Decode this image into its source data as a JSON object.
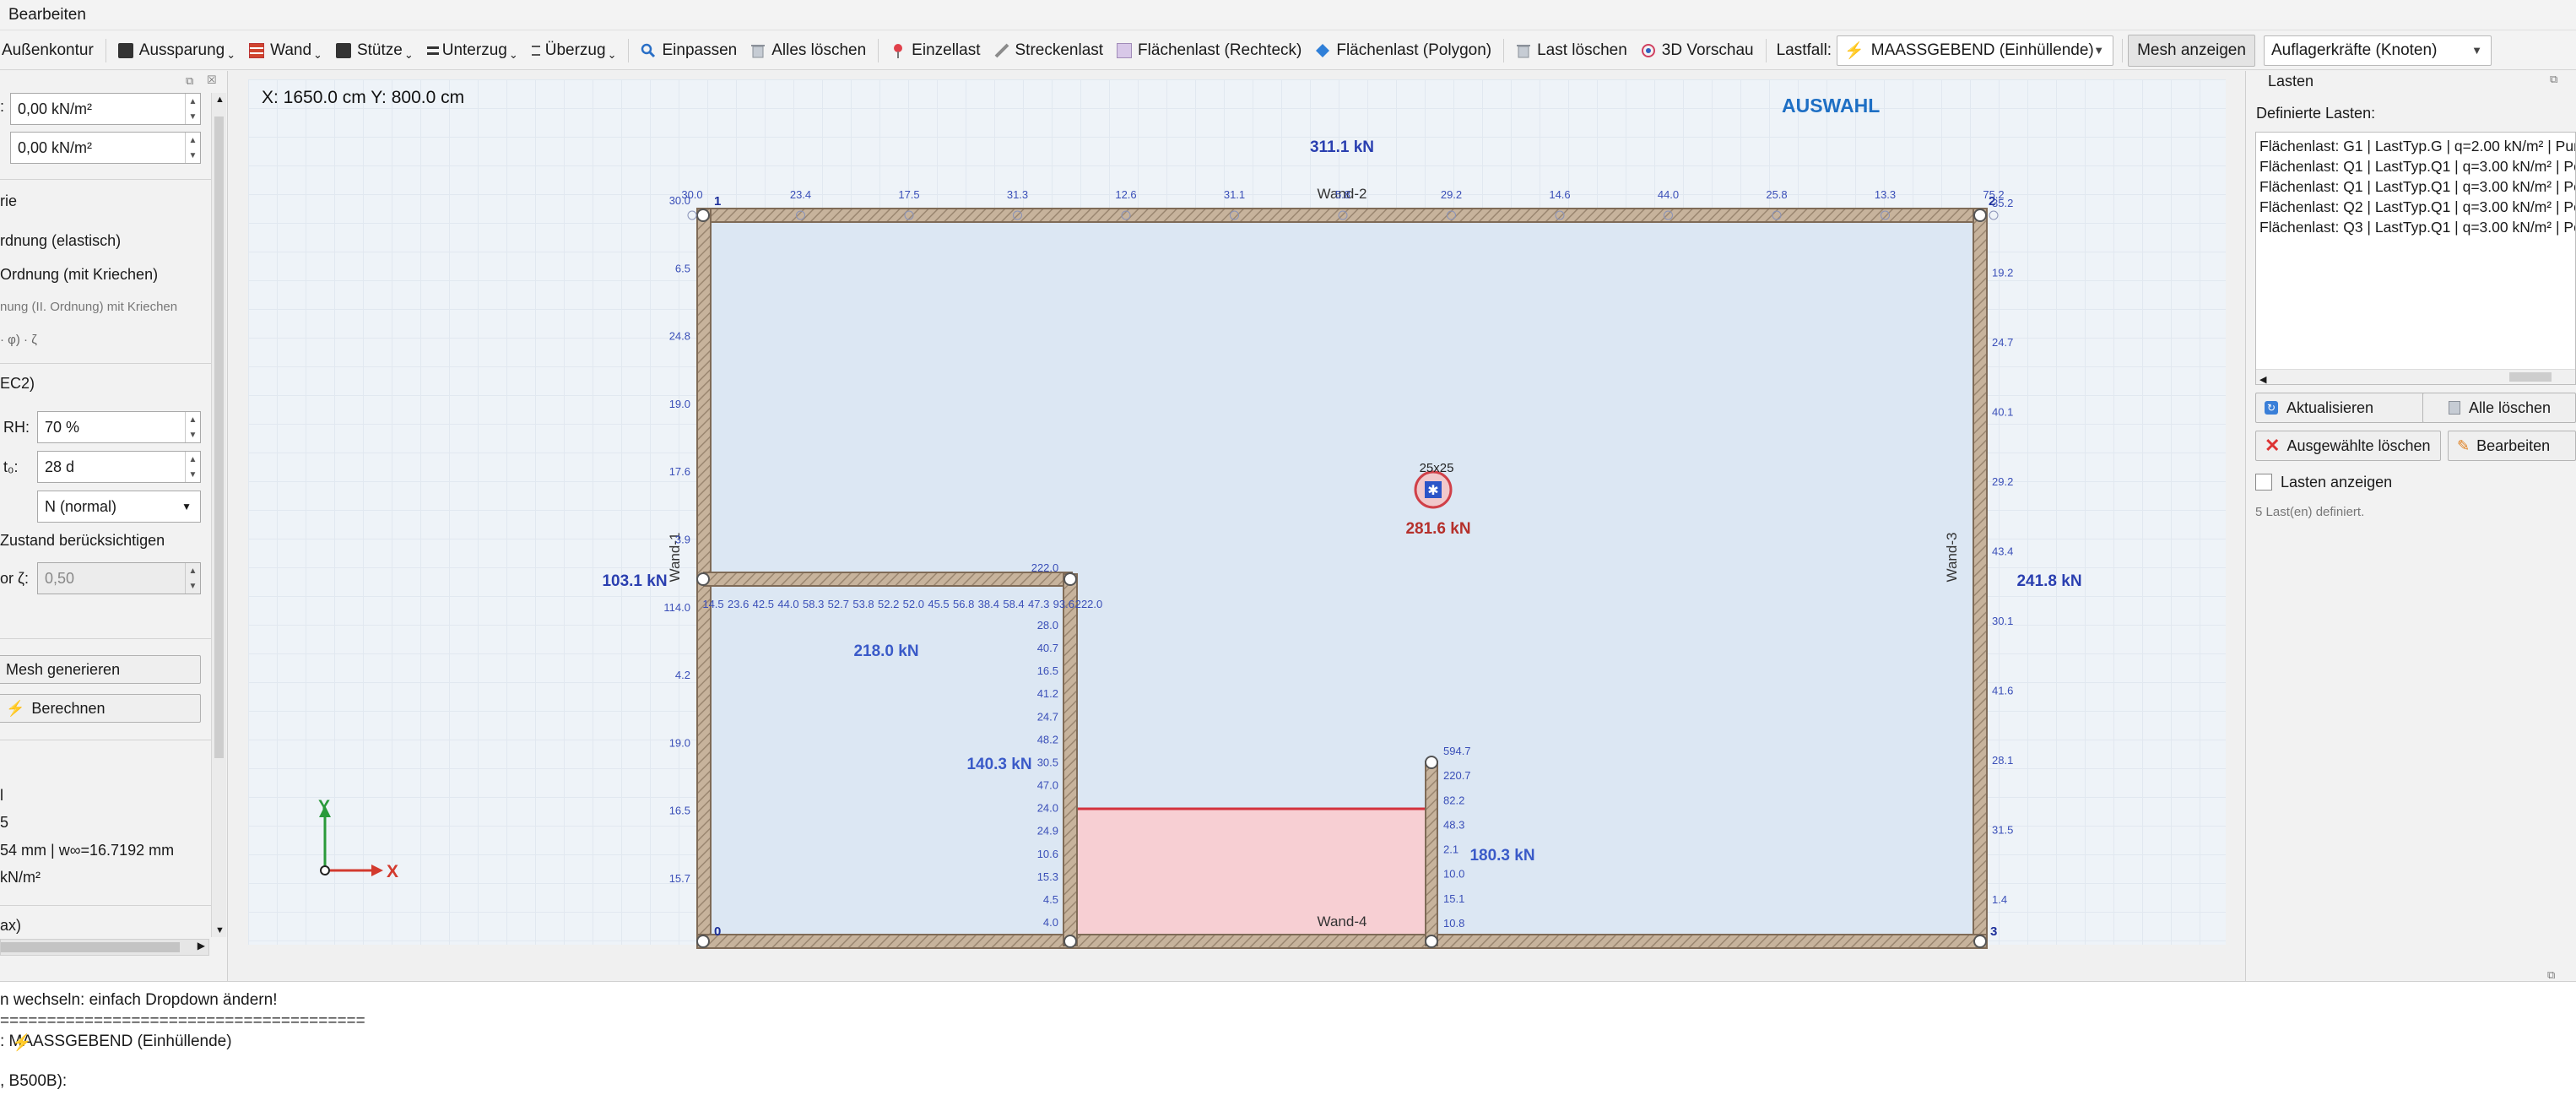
{
  "menubar": {
    "bearbeiten": "Bearbeiten"
  },
  "toolbar": {
    "aussenkontur": "Außenkontur",
    "aussparung": "Aussparung",
    "wand": "Wand",
    "stuetze": "Stütze",
    "unterzug": "Unterzug",
    "ueberzug": "Überzug",
    "einpassen": "Einpassen",
    "alles_loeschen": "Alles löschen",
    "einzellast": "Einzellast",
    "streckenlast": "Streckenlast",
    "flaechenlast_rechteck": "Flächenlast (Rechteck)",
    "flaechenlast_polygon": "Flächenlast (Polygon)",
    "last_loeschen": "Last löschen",
    "vorschau_3d": "3D Vorschau",
    "lastfall_label": "Lastfall:",
    "lastfall_value": "MAASSGEBEND (Einhüllende)",
    "mesh_anzeigen": "Mesh anzeigen",
    "ergebnis_value": "Auflagerkräfte (Knoten)"
  },
  "left_panel": {
    "field1_value": "0,00 kN/m²",
    "field2_value": "0,00 kN/m²",
    "section_theorie": "rie",
    "option_elastisch": "rdnung (elastisch)",
    "option_kriechen": "Ordnung (mit Kriechen)",
    "hint_kriechen": "nung (II. Ordnung) mit Kriechen",
    "formula": "· φ) · ζ",
    "section_ec2": "EC2)",
    "rh_label": "RH:",
    "rh_value": "70 %",
    "t0_label": "t₀:",
    "t0_value": "28 d",
    "cement_value": "N (normal)",
    "zustand_label": "Zustand berücksichtigen",
    "zeta_label": "or ζ:",
    "zeta_value": "0,50",
    "mesh_button": "Mesh generieren",
    "calc_button": "Berechnen",
    "res1": "l",
    "res2": "5",
    "res3": "54 mm  |  w∞=16.7192 mm",
    "res4": "kN/m²",
    "res5": "ax)"
  },
  "canvas": {
    "coord_readout": "X: 1650.0 cm  Y: 800.0 cm",
    "auswahl_label": "AUSWAHL",
    "axis_y": "Y",
    "axis_x": "X",
    "wall_labels": [
      "Wand-1",
      "Wand-2",
      "Wand-3",
      "Wand-4"
    ],
    "node_labels": [
      "0",
      "1",
      "2",
      "3"
    ],
    "column_label": "25x25",
    "reactions": {
      "top": "311.1 kN",
      "left": "103.1 kN",
      "right": "241.8 kN",
      "inner_horizontal": "218.0 kN",
      "inner_vertical": "140.3 kN",
      "stub": "180.3 kN",
      "column": "281.6 kN"
    },
    "top_edge_values": [
      "30.0",
      "23.4",
      "17.5",
      "31.3",
      "12.6",
      "31.1",
      "5.8",
      "29.2",
      "14.6",
      "44.0",
      "25.8",
      "13.3",
      "75.2"
    ],
    "left_edge_values": [
      "30.0",
      "6.5",
      "24.8",
      "19.0",
      "17.6",
      "3.9",
      "114.0",
      "4.2",
      "19.0",
      "16.5",
      "15.7"
    ],
    "right_edge_values": [
      "35.2",
      "19.2",
      "24.7",
      "40.1",
      "29.2",
      "43.4",
      "30.1",
      "41.6",
      "28.1",
      "31.5",
      "1.4"
    ],
    "inner_horizontal_values": [
      "14.5",
      "23.6",
      "42.5",
      "44.0",
      "58.3",
      "52.7",
      "53.8",
      "52.2",
      "52.0",
      "45.5",
      "56.8",
      "38.4",
      "58.4",
      "47.3",
      "93.6",
      "222.0"
    ],
    "inner_top_value": "222.0",
    "inner_vertical_values": [
      "28.0",
      "40.7",
      "16.5",
      "41.2",
      "24.7",
      "48.2",
      "30.5",
      "47.0",
      "24.0",
      "24.9",
      "10.6",
      "15.3",
      "4.5",
      "4.0"
    ],
    "stub_values": [
      "594.7",
      "220.7",
      "82.2",
      "48.3",
      "2.1",
      "10.0",
      "15.1",
      "10.8"
    ]
  },
  "right_panel": {
    "title": "Lasten",
    "definierte_label": "Definierte Lasten:",
    "loads": [
      "Flächenlast: G1 | LastTyp.G | q=2.00 kN/m² | Pun",
      "Flächenlast: Q1 | LastTyp.Q1 | q=3.00 kN/m² | Po",
      "Flächenlast: Q1 | LastTyp.Q1 | q=3.00 kN/m² | Po",
      "Flächenlast: Q2 | LastTyp.Q1 | q=3.00 kN/m² | Po",
      "Flächenlast: Q3 | LastTyp.Q1 | q=3.00 kN/m² | Po"
    ],
    "aktualisieren": "Aktualisieren",
    "alle_loeschen": "Alle löschen",
    "ausgewaehlte_loeschen": "Ausgewählte löschen",
    "bearbeiten": "Bearbeiten",
    "lasten_anzeigen": "Lasten anzeigen",
    "count_info": "5 Last(en) definiert."
  },
  "console": {
    "line1": "n wechseln: einfach Dropdown ändern!",
    "line2": "=======================================",
    "line3": ":  MAASSGEBEND (Einhüllende)",
    "line4": ", B500B):"
  },
  "colors": {
    "accent": "#1e6fc4",
    "wall": "#b9a58f",
    "slab": "#dde8f4",
    "selection": "#f6cfd2",
    "reaction": "#2a3fb0",
    "column_reaction": "#b5302b"
  }
}
